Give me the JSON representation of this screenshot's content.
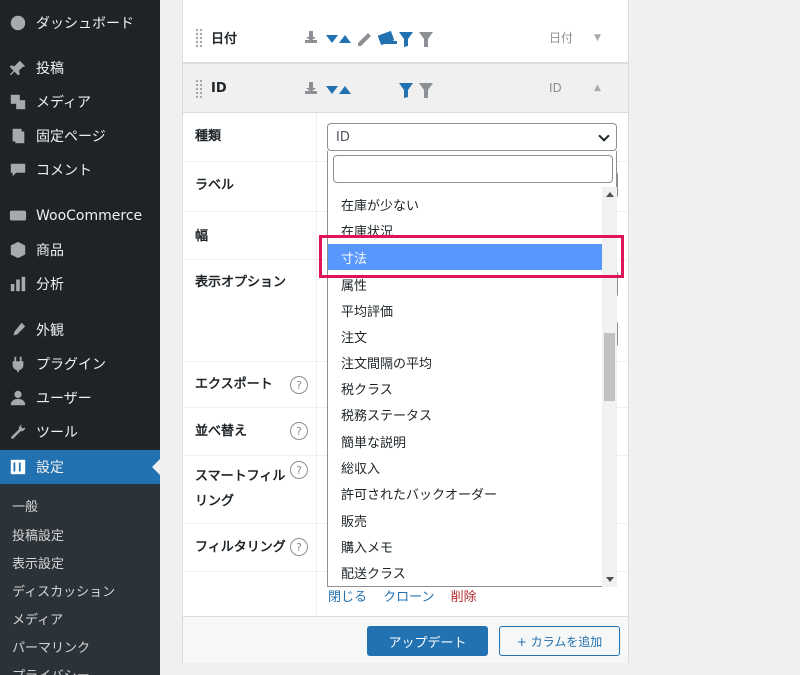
{
  "sidebar": {
    "items": [
      {
        "label": "ダッシュボード",
        "icon": "dashboard-icon"
      },
      {
        "label": "投稿",
        "icon": "pin-icon"
      },
      {
        "label": "メディア",
        "icon": "media-icon"
      },
      {
        "label": "固定ページ",
        "icon": "pages-icon"
      },
      {
        "label": "コメント",
        "icon": "comment-icon"
      },
      {
        "label": "WooCommerce",
        "icon": "woocommerce-icon"
      },
      {
        "label": "商品",
        "icon": "products-icon"
      },
      {
        "label": "分析",
        "icon": "analytics-icon"
      },
      {
        "label": "外観",
        "icon": "appearance-icon"
      },
      {
        "label": "プラグイン",
        "icon": "plugins-icon"
      },
      {
        "label": "ユーザー",
        "icon": "users-icon"
      },
      {
        "label": "ツール",
        "icon": "tools-icon"
      },
      {
        "label": "設定",
        "icon": "settings-icon",
        "active": true
      }
    ],
    "submenu": [
      "一般",
      "投稿設定",
      "表示設定",
      "ディスカッション",
      "メディア",
      "パーマリンク",
      "プライバシー"
    ]
  },
  "columns": {
    "date": {
      "label": "日付",
      "type": "日付"
    },
    "id": {
      "label": "ID",
      "type": "ID"
    }
  },
  "settings_rows": {
    "type": "種類",
    "label": "ラベル",
    "width": "幅",
    "display_options": "表示オプション",
    "export": "エクスポート",
    "sort": "並べ替え",
    "smart_filtering": "スマートフィルタリング",
    "smart_filtering_line1": "スマートフィル",
    "smart_filtering_line2": "リング",
    "filtering": "フィルタリング",
    "help_glyph": "?"
  },
  "select": {
    "value": "ID",
    "options": [
      "在庫が少ない",
      "在庫状況",
      "寸法",
      "属性",
      "平均評価",
      "注文",
      "注文間隔の平均",
      "税クラス",
      "税務ステータス",
      "簡単な説明",
      "総収入",
      "許可されたバックオーダー",
      "販売",
      "購入メモ",
      "配送クラス"
    ],
    "highlighted": "寸法"
  },
  "actions": {
    "close": "閉じる",
    "clone": "クローン",
    "delete": "削除"
  },
  "footer": {
    "update": "アップデート",
    "add_column": "+ カラムを追加"
  },
  "colors": {
    "sidebar_bg": "#1d2327",
    "accent": "#2271b1",
    "highlight": "#5897fb",
    "annotation": "#e0145a",
    "delete": "#b32d2e"
  }
}
